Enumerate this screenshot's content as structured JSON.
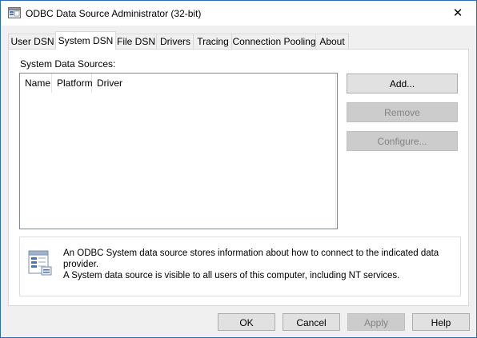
{
  "window": {
    "title": "ODBC Data Source Administrator (32-bit)",
    "close_glyph": "✕",
    "title_icon": "odbc-admin-icon"
  },
  "tabs": [
    {
      "label": "User DSN",
      "active": false
    },
    {
      "label": "System DSN",
      "active": true
    },
    {
      "label": "File DSN",
      "active": false
    },
    {
      "label": "Drivers",
      "active": false
    },
    {
      "label": "Tracing",
      "active": false
    },
    {
      "label": "Connection Pooling",
      "active": false
    },
    {
      "label": "About",
      "active": false
    }
  ],
  "panel": {
    "section_label": "System Data Sources:",
    "columns": [
      "Name",
      "Platform",
      "Driver"
    ],
    "rows": [],
    "buttons": {
      "add": {
        "label": "Add...",
        "enabled": true
      },
      "remove": {
        "label": "Remove",
        "enabled": false
      },
      "configure": {
        "label": "Configure...",
        "enabled": false
      }
    },
    "info": {
      "icon": "data-source-info-icon",
      "line1": "An ODBC System data source stores information about how to connect to the indicated data provider.",
      "line2": "A System data source is visible to all users of this computer, including NT services."
    }
  },
  "footer": {
    "ok": {
      "label": "OK",
      "enabled": true
    },
    "cancel": {
      "label": "Cancel",
      "enabled": true
    },
    "apply": {
      "label": "Apply",
      "enabled": false
    },
    "help": {
      "label": "Help",
      "enabled": true
    }
  }
}
